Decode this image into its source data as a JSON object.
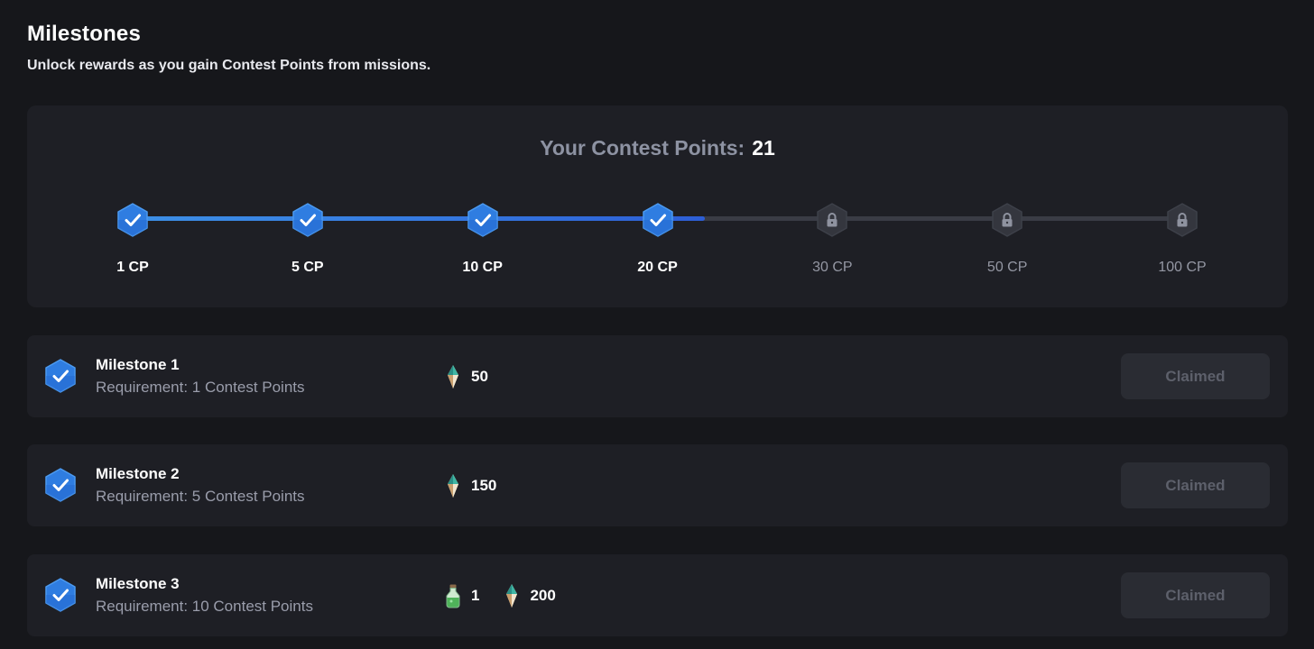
{
  "header": {
    "title": "Milestones",
    "subtitle": "Unlock rewards as you gain Contest Points from missions."
  },
  "progress": {
    "label": "Your Contest Points:",
    "value": "21",
    "current_points": 21,
    "fill_fraction": 0.545,
    "colors": {
      "completed": "#3d8fe6",
      "locked": "#3a3c45"
    },
    "nodes": [
      {
        "label": "1 CP",
        "state": "completed",
        "icon": "check-icon"
      },
      {
        "label": "5 CP",
        "state": "completed",
        "icon": "check-icon"
      },
      {
        "label": "10 CP",
        "state": "completed",
        "icon": "check-icon"
      },
      {
        "label": "20 CP",
        "state": "completed",
        "icon": "check-icon"
      },
      {
        "label": "30 CP",
        "state": "locked",
        "icon": "lock-icon"
      },
      {
        "label": "50 CP",
        "state": "locked",
        "icon": "lock-icon"
      },
      {
        "label": "100 CP",
        "state": "locked",
        "icon": "lock-icon"
      }
    ]
  },
  "milestones": [
    {
      "name": "Milestone 1",
      "requirement": "Requirement: 1 Contest Points",
      "rewards": [
        {
          "icon": "gem-icon",
          "amount": "50"
        }
      ],
      "button": "Claimed"
    },
    {
      "name": "Milestone 2",
      "requirement": "Requirement: 5 Contest Points",
      "rewards": [
        {
          "icon": "gem-icon",
          "amount": "150"
        }
      ],
      "button": "Claimed"
    },
    {
      "name": "Milestone 3",
      "requirement": "Requirement: 10 Contest Points",
      "rewards": [
        {
          "icon": "potion-icon",
          "amount": "1"
        },
        {
          "icon": "gem-icon",
          "amount": "200"
        }
      ],
      "button": "Claimed"
    }
  ]
}
